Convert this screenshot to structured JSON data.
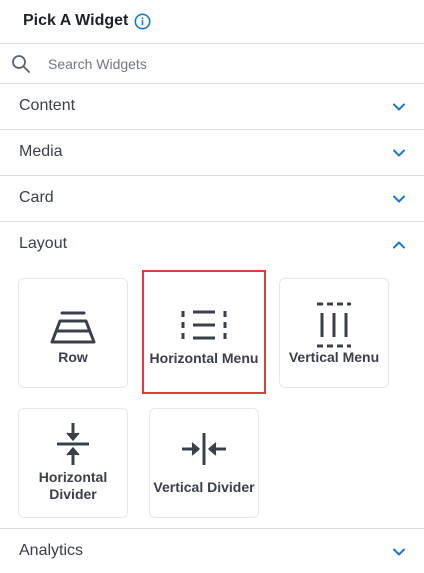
{
  "panel": {
    "title": "Pick A Widget",
    "info_icon": "info-circle-icon"
  },
  "search": {
    "placeholder": "Search Widgets",
    "value": "",
    "icon": "search-icon"
  },
  "sections": [
    {
      "label": "Content",
      "state": "collapsed"
    },
    {
      "label": "Media",
      "state": "collapsed"
    },
    {
      "label": "Card",
      "state": "collapsed"
    },
    {
      "label": "Layout",
      "state": "expanded"
    },
    {
      "label": "Analytics",
      "state": "collapsed"
    }
  ],
  "layout_widgets": [
    {
      "label": "Row",
      "icon": "row-icon",
      "selected": false
    },
    {
      "label": "Horizontal Menu",
      "icon": "horizontal-menu-icon",
      "selected": true
    },
    {
      "label": "Vertical Menu",
      "icon": "vertical-menu-icon",
      "selected": false
    },
    {
      "label": "Horizontal Divider",
      "label_line1": "Horizontal",
      "label_line2": "Divider",
      "icon": "horizontal-divider-icon",
      "selected": false
    },
    {
      "label": "Vertical Divider",
      "icon": "vertical-divider-icon",
      "selected": false
    }
  ],
  "colors": {
    "accent": "#1f78c8",
    "selected_border": "#d9413c",
    "icon": "#3a3f4a",
    "divider": "#dcdfe4"
  }
}
